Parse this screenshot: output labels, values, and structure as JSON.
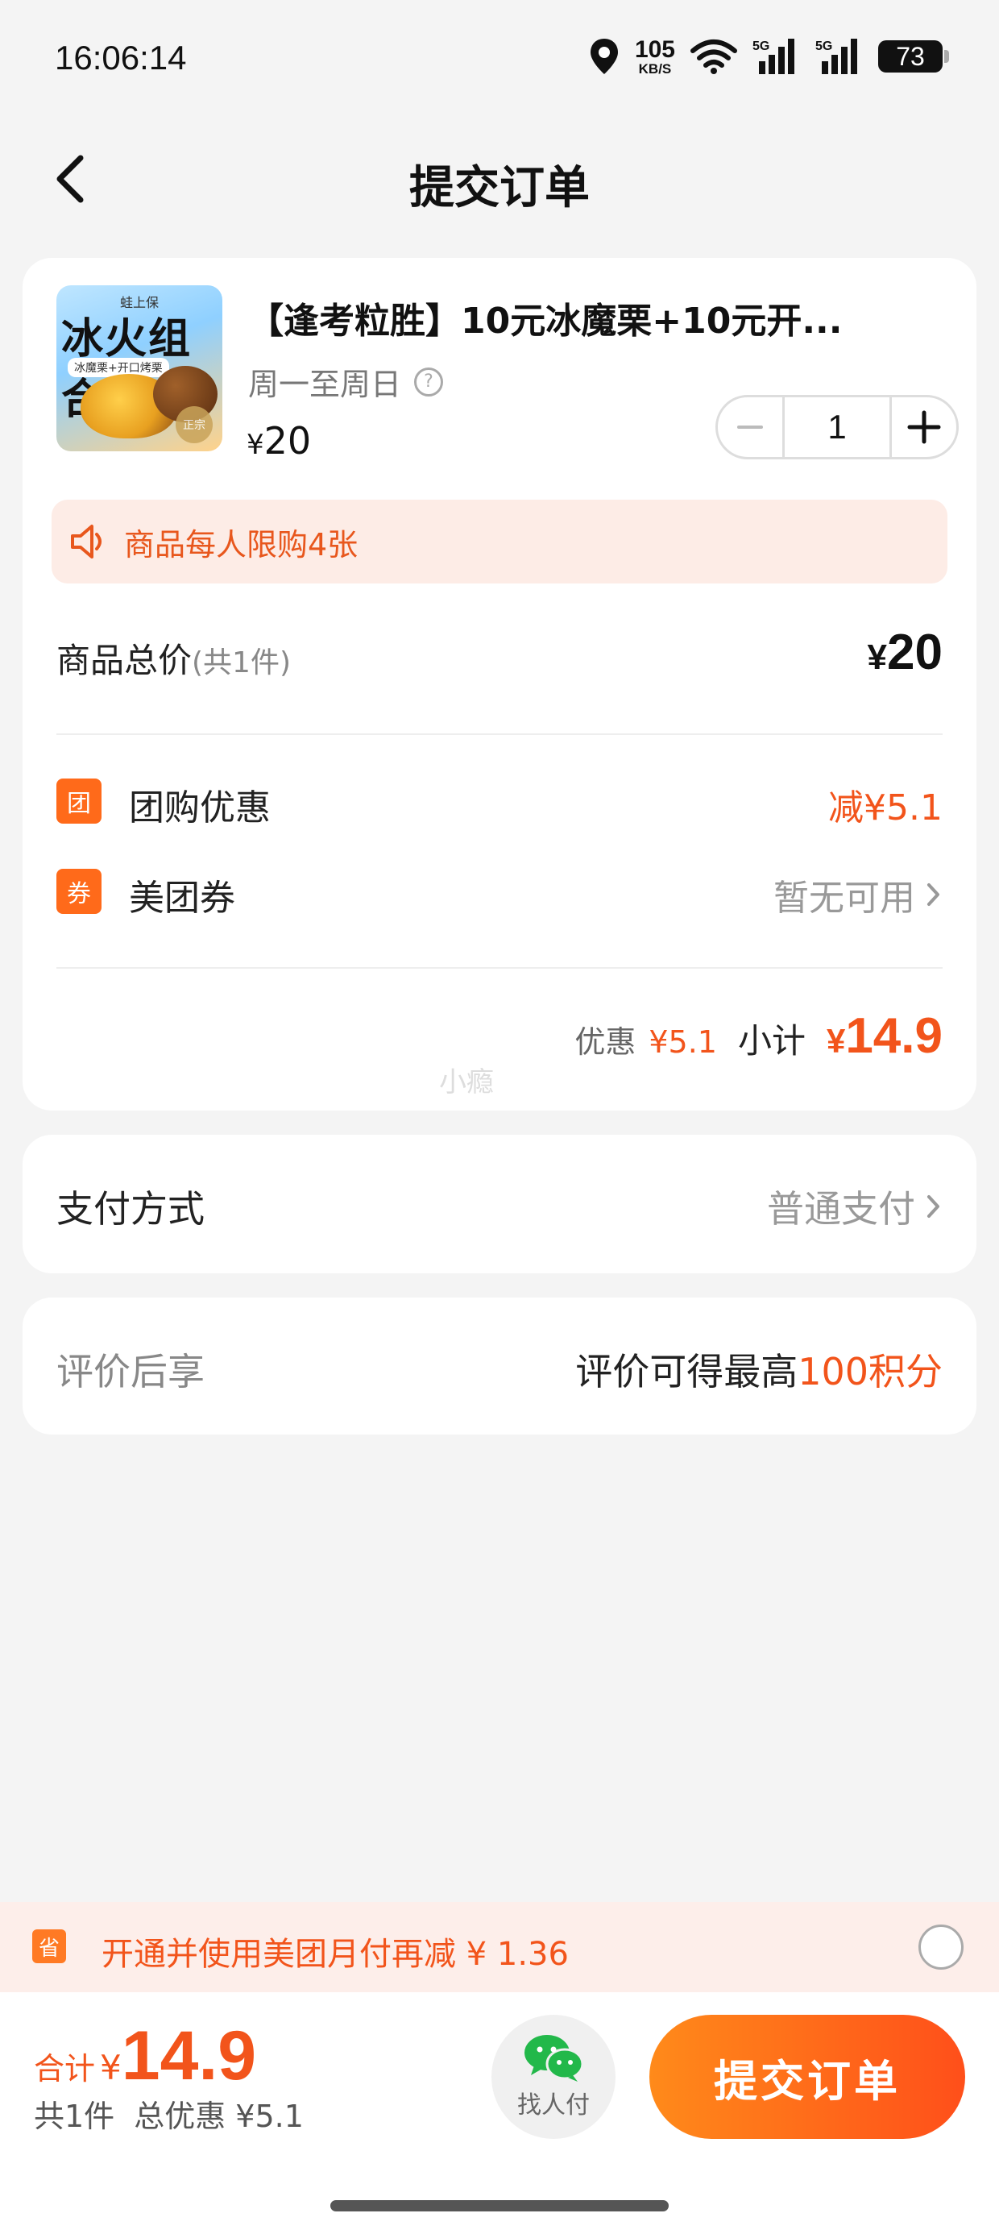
{
  "status_bar": {
    "time": "16:06:14",
    "net_speed_value": "105",
    "net_speed_unit": "KB/S",
    "signal_1_label": "5G",
    "signal_2_label": "5G",
    "battery": "73"
  },
  "header": {
    "title": "提交订单"
  },
  "product": {
    "image_banner_top": "蛙上保",
    "image_text": "冰火组合",
    "image_sub": "冰魔栗+开口烤栗",
    "image_seal": "正宗",
    "title": "【逢考粒胜】10元冰魔栗+10元开...",
    "subtitle": "周一至周日",
    "price_symbol": "¥",
    "price": "20",
    "quantity": "1"
  },
  "limit_notice": "商品每人限购4张",
  "total": {
    "label": "商品总价",
    "count": "(共1件)",
    "symbol": "¥",
    "value": "20"
  },
  "discounts": [
    {
      "badge": "团",
      "label": "团购优惠",
      "value": "减¥5.1"
    },
    {
      "badge": "券",
      "label": "美团券",
      "value": "暂无可用"
    }
  ],
  "subtotal": {
    "discount_label": "优惠",
    "discount_value": "¥5.1",
    "label": "小计",
    "symbol": "¥",
    "value": "14.9"
  },
  "watermark": "小瘾",
  "payment": {
    "label": "支付方式",
    "value": "普通支付"
  },
  "review": {
    "label": "评价后享",
    "value_prefix": "评价可得最高",
    "value_highlight": "100积分"
  },
  "monthly_pay": {
    "badge": "省",
    "text": "开通并使用美团月付再减 ¥ 1.36"
  },
  "bottom": {
    "total_label": "合计",
    "total_symbol": "¥",
    "total_value": "14.9",
    "count_text": "共1件",
    "discount_text": "总优惠 ¥5.1",
    "find_pay_label": "找人付",
    "submit_label": "提交订单"
  },
  "colors": {
    "accent": "#f2541b",
    "button_start": "#ff8a1a",
    "button_end": "#ff4f1a",
    "notice_bg": "#fdece6"
  }
}
